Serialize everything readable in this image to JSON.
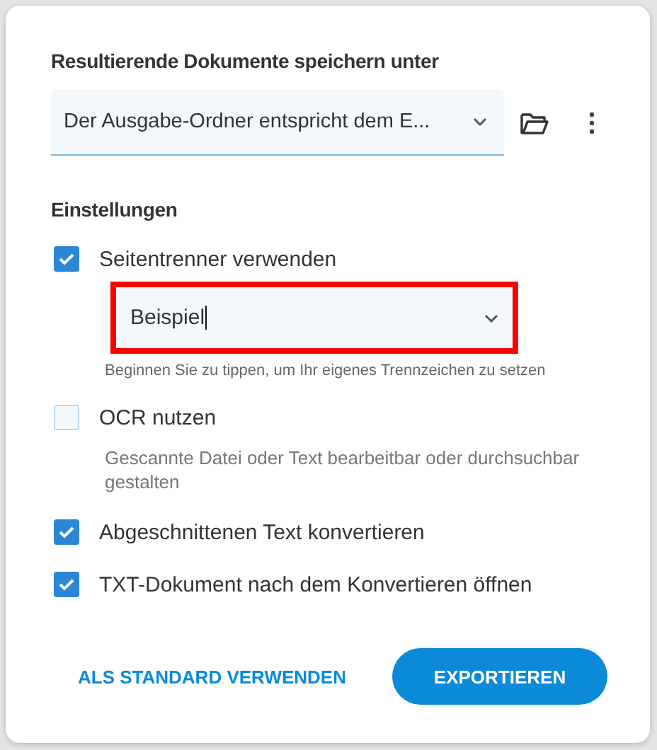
{
  "output": {
    "heading": "Resultierende Dokumente speichern unter",
    "value": "Der Ausgabe-Ordner entspricht dem E..."
  },
  "settings": {
    "heading": "Einstellungen",
    "options": [
      {
        "label": "Seitentrenner verwenden",
        "checked": true,
        "field": {
          "value": "Beispiel",
          "highlighted": true,
          "hint": "Beginnen Sie zu tippen, um Ihr eigenes Trennzeichen zu setzen"
        }
      },
      {
        "label": "OCR nutzen",
        "checked": false,
        "description": "Gescannte Datei oder Text bearbeitbar oder durchsuchbar gestalten"
      },
      {
        "label": "Abgeschnittenen Text konvertieren",
        "checked": true
      },
      {
        "label": "TXT-Dokument nach dem Konvertieren öffnen",
        "checked": true
      }
    ]
  },
  "buttons": {
    "secondary": "ALS STANDARD VERWENDEN",
    "primary": "EXPORTIEREN"
  }
}
